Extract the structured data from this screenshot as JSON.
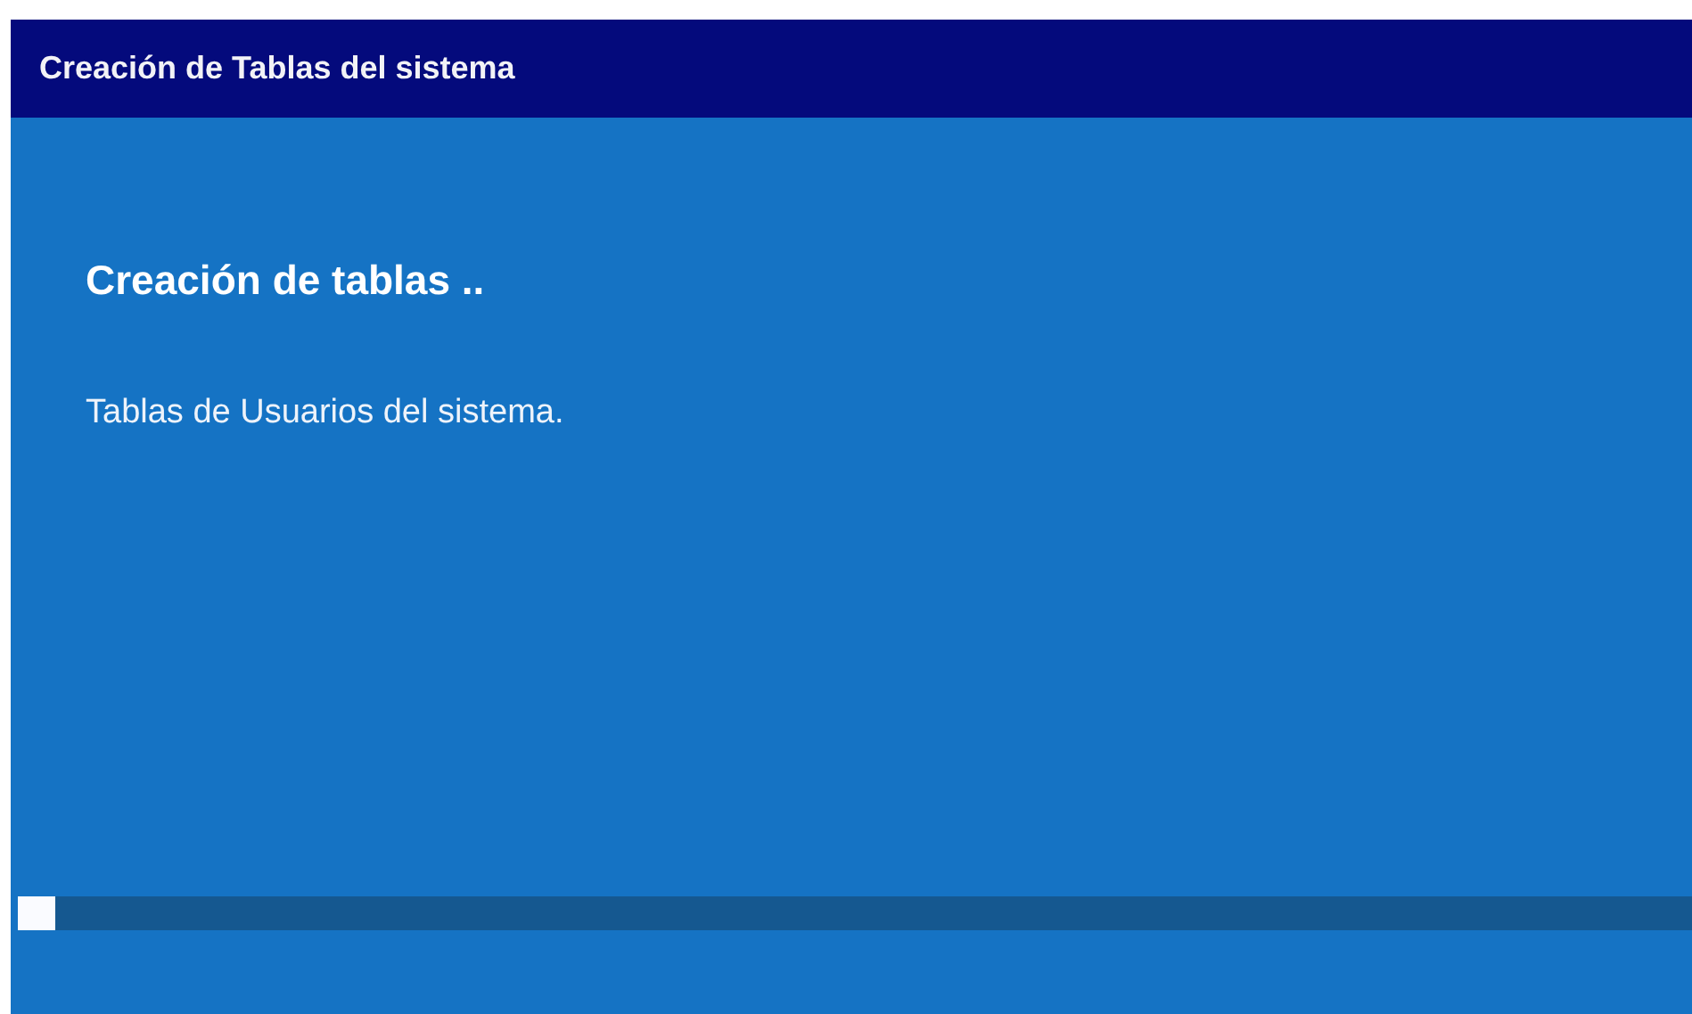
{
  "window": {
    "title": "Creación de Tablas del sistema"
  },
  "heading": "Creación de tablas ..",
  "message": "Tablas de Usuarios del sistema.",
  "progress": {
    "level": 0.022
  }
}
